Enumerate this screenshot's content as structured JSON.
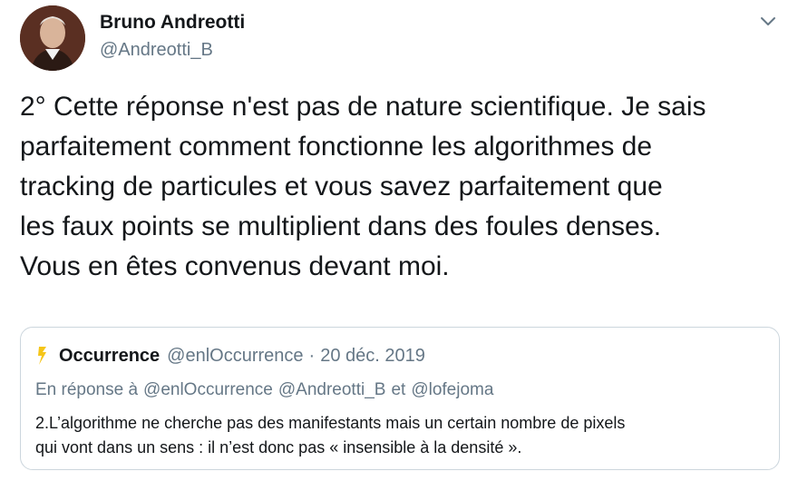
{
  "author": {
    "display_name": "Bruno Andreotti",
    "handle": "@Andreotti_B"
  },
  "tweet": {
    "text": "2° Cette réponse n'est pas de nature scientifique. Je sais\nparfaitement comment fonctionne les algorithmes de\ntracking de particules et vous savez parfaitement que\nles faux points se multiplient dans des foules denses.\nVous en êtes convenus devant moi."
  },
  "quoted": {
    "display_name": "Occurrence",
    "handle": "@enlOccurrence",
    "separator": "·",
    "date": "20 déc. 2019",
    "reply_prefix": "En réponse à",
    "reply_to_1": "@enlOccurrence",
    "reply_to_2": "@Andreotti_B",
    "reply_conjunction": "et",
    "reply_to_3": "@lofejoma",
    "text_line1": "2.L’algorithme ne cherche pas des manifestants mais un certain nombre de pixels",
    "text_line2": "qui vont dans un sens : il n’est donc pas « insensible à la densité »."
  },
  "colors": {
    "text": "#14171a",
    "secondary": "#657786",
    "border": "#ccd6dd",
    "logo_yellow": "#f5c518"
  },
  "icons": {
    "caret": "chevron-down-icon",
    "quote_logo": "occurrence-logo-icon"
  }
}
